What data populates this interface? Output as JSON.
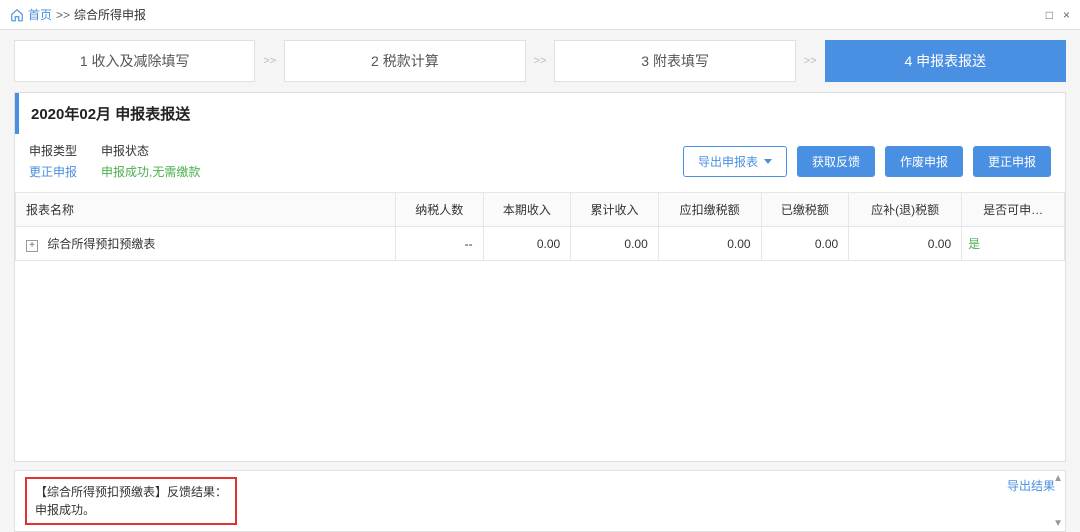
{
  "breadcrumb": {
    "home": "首页",
    "sep": ">>",
    "current": "综合所得申报"
  },
  "window_controls": {
    "max": "□",
    "close": "×"
  },
  "steps": {
    "s1": "1 收入及减除填写",
    "s2": "2 税款计算",
    "s3": "3 附表填写",
    "s4": "4 申报表报送",
    "sep": ">>"
  },
  "page_title": "2020年02月  申报表报送",
  "meta": {
    "type_label": "申报类型",
    "type_value": "更正申报",
    "status_label": "申报状态",
    "status_value": "申报成功,无需缴款"
  },
  "buttons": {
    "export": "导出申报表",
    "get_feedback": "获取反馈",
    "void": "作废申报",
    "correct": "更正申报"
  },
  "table": {
    "headers": {
      "name": "报表名称",
      "taxpayers": "纳税人数",
      "current_income": "本期收入",
      "cum_income": "累计收入",
      "should_deduct": "应扣缴税额",
      "paid": "已缴税额",
      "refund": "应补(退)税额",
      "can": "是否可申…"
    },
    "row1": {
      "name": "综合所得预扣预缴表",
      "taxpayers": "--",
      "current_income": "0.00",
      "cum_income": "0.00",
      "should_deduct": "0.00",
      "paid": "0.00",
      "refund": "0.00",
      "can": "是"
    }
  },
  "feedback": {
    "line1": "【综合所得预扣预缴表】反馈结果：",
    "line2": "申报成功。",
    "export_link": "导出结果"
  }
}
